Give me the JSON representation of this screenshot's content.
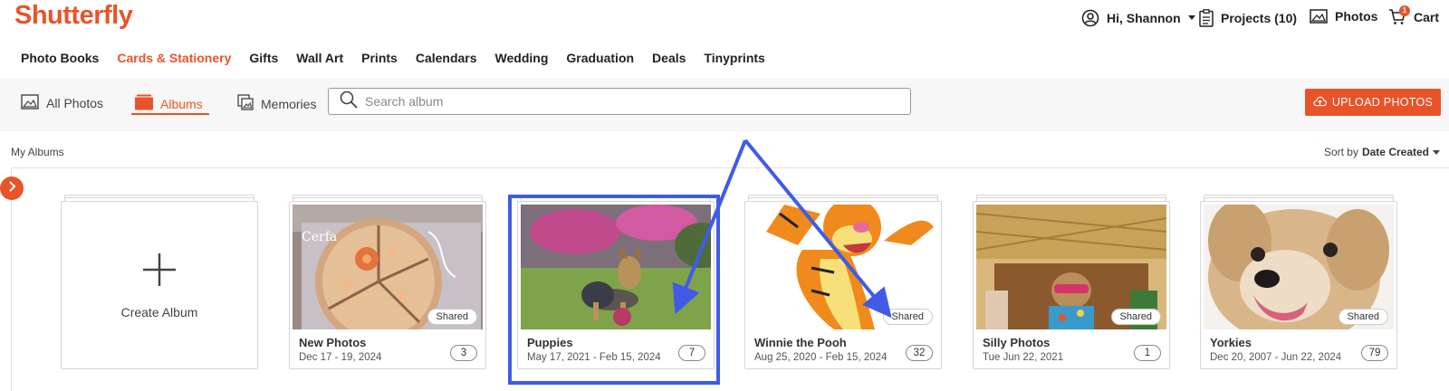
{
  "header": {
    "logo": "Shutterfly",
    "greeting": "Hi, Shannon",
    "projects": "Projects (10)",
    "photos": "Photos",
    "cart": "Cart",
    "cart_count": "1",
    "brand_color": "#e8542a"
  },
  "categories": [
    "Photo Books",
    "Cards & Stationery",
    "Gifts",
    "Wall Art",
    "Prints",
    "Calendars",
    "Wedding",
    "Graduation",
    "Deals",
    "Tinyprints"
  ],
  "active_category": "Cards & Stationery",
  "toolbar": {
    "all_photos": "All Photos",
    "albums": "Albums",
    "memories": "Memories",
    "search_placeholder": "Search album",
    "upload": "UPLOAD PHOTOS"
  },
  "albums_section": {
    "heading": "My Albums",
    "sort_prefix": "Sort by",
    "sort_value": "Date Created"
  },
  "create_album": "Create Album",
  "albums": [
    {
      "title": "New Photos",
      "dates": "Dec 17 - 19, 2024",
      "count": "3",
      "badge": "Shared"
    },
    {
      "title": "Puppies",
      "dates": "May 17, 2021 - Feb 15, 2024",
      "count": "7",
      "badge": ""
    },
    {
      "title": "Winnie the Pooh",
      "dates": "Aug 25, 2020 - Feb 15, 2024",
      "count": "32",
      "badge": "Shared"
    },
    {
      "title": "Silly Photos",
      "dates": "Tue Jun 22, 2021",
      "count": "1",
      "badge": "Shared"
    },
    {
      "title": "Yorkies",
      "dates": "Dec 20, 2007 - Jun 22, 2024",
      "count": "79",
      "badge": "Shared"
    }
  ],
  "thumb_text": {
    "album_0": "Cerfa"
  },
  "annotation_color": "#3f5be8"
}
